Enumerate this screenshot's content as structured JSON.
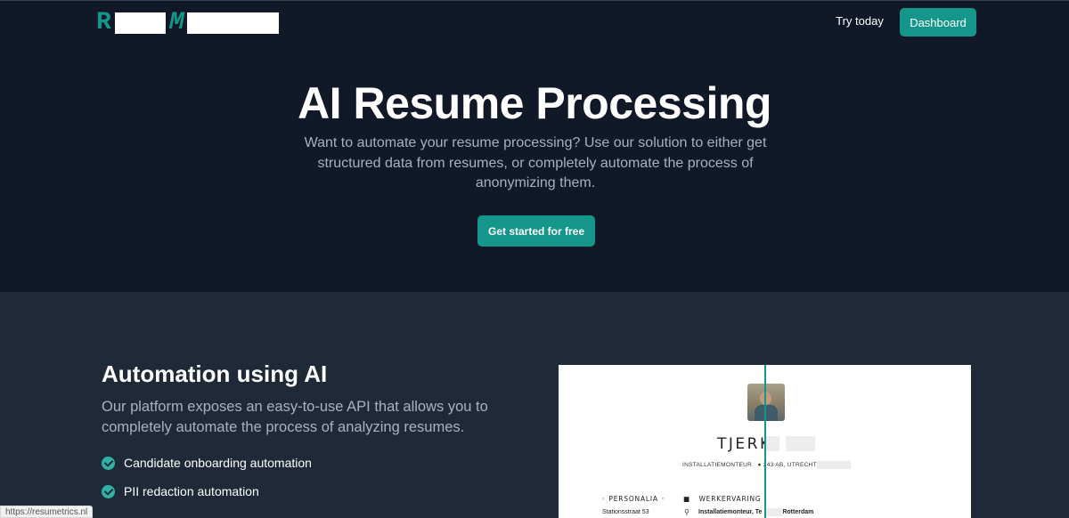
{
  "header": {
    "logo_letters": [
      "R",
      "M"
    ],
    "nav_try": "Try today",
    "dashboard_label": "Dashboard"
  },
  "hero": {
    "title": "AI Resume Processing",
    "subtitle": "Want to automate your resume processing? Use our solution to either get structured data from resumes, or completely automate the process of anonymizing them.",
    "cta_label": "Get started for free"
  },
  "section": {
    "title": "Automation using AI",
    "description": "Our platform exposes an easy-to-use API that allows you to completely automate the process of analyzing resumes.",
    "features": [
      "Candidate onboarding automation",
      "PII redaction automation"
    ]
  },
  "resume_preview": {
    "name": "TJERK",
    "meta_job": "INSTALLATIEMONTEUR",
    "meta_location": "243  AB, UTRECHT",
    "section_left": "PERSONALIA",
    "section_right": "WERKERVARING",
    "line_left": "Stationsstraat 53",
    "line_right_a": "Installatiemonteur, Te",
    "line_right_b": ", Rotterdam"
  },
  "status_bar": {
    "url": "https://resumetrics.nl"
  },
  "colors": {
    "accent": "#14978a",
    "hero_bg": "#111827",
    "section_bg": "#1f2937",
    "muted_text": "#a8b1c0"
  },
  "icons": [
    "check-circle-icon",
    "location-pin-icon",
    "phone-icon",
    "briefcase-icon",
    "timeline-icon"
  ]
}
